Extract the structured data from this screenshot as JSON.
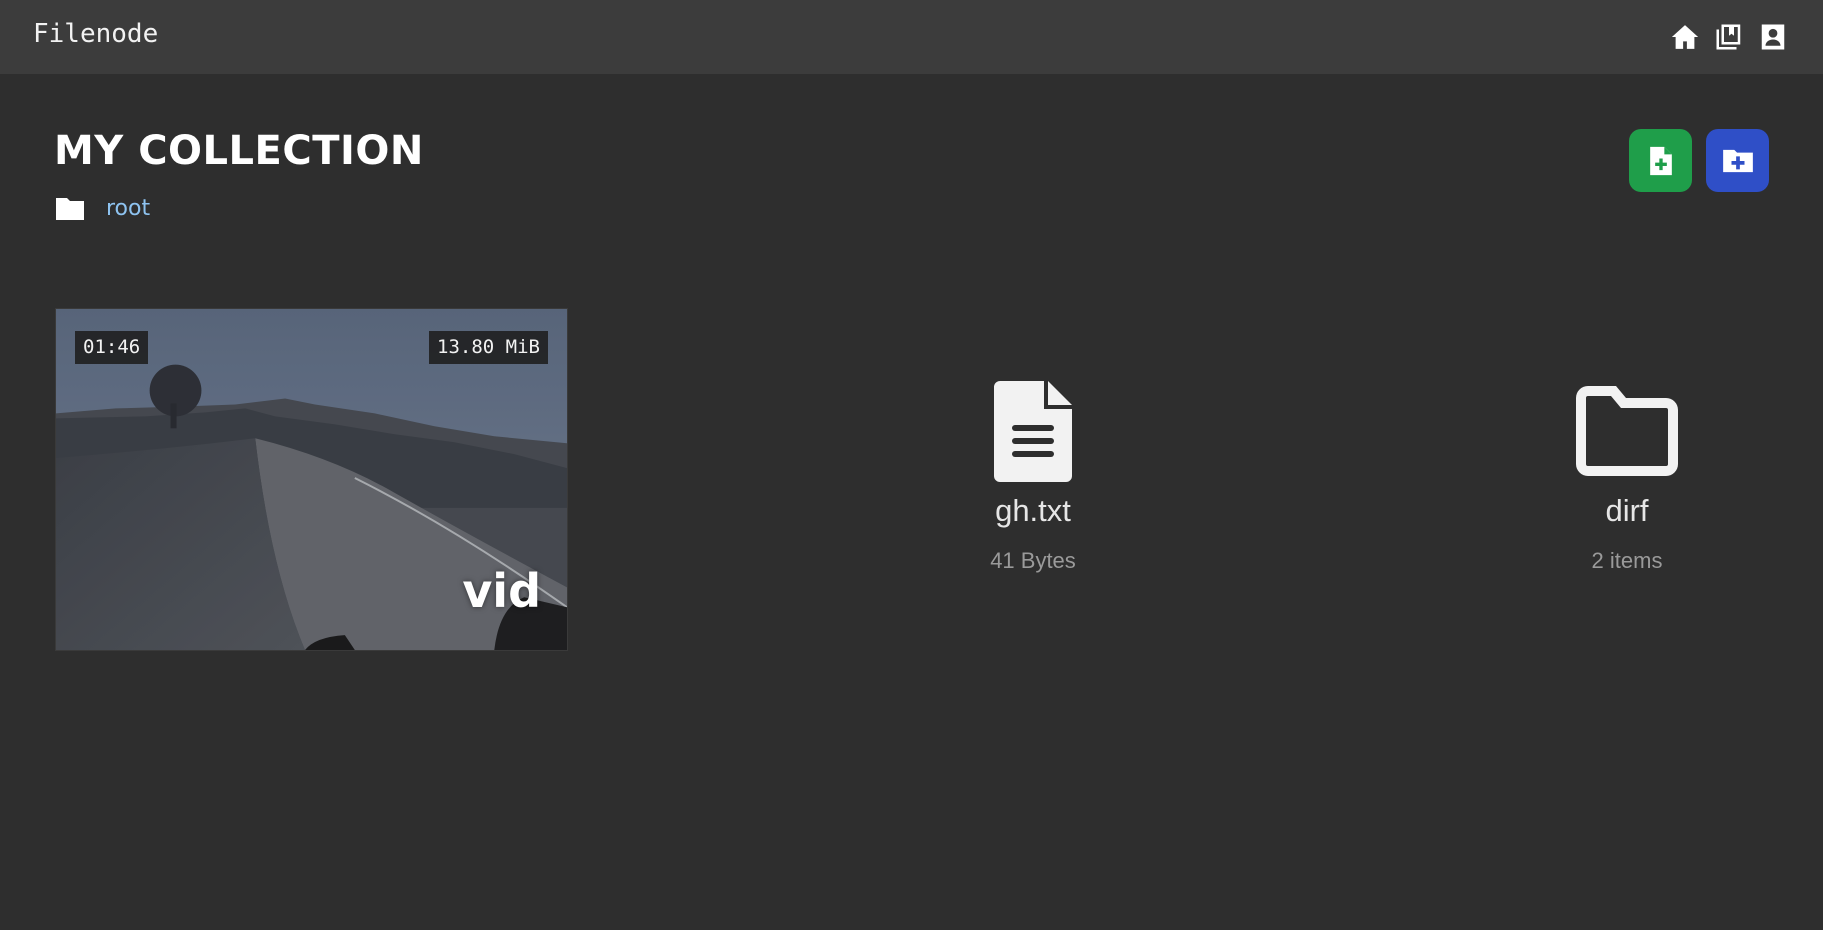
{
  "app": {
    "brand": "Filenode"
  },
  "navbar": {
    "icons": [
      {
        "name": "home-icon"
      },
      {
        "name": "bookmarks-icon"
      },
      {
        "name": "account-icon"
      }
    ]
  },
  "header": {
    "title": "MY COLLECTION",
    "breadcrumb": [
      {
        "label": "root",
        "icon": "folder-icon"
      }
    ]
  },
  "actions": {
    "new_file": {
      "icon": "file-plus-icon",
      "color": "#1f9e4a"
    },
    "new_folder": {
      "icon": "folder-plus-icon",
      "color": "#2f4fc7"
    }
  },
  "items": {
    "video": {
      "name": "vid",
      "duration": "01:46",
      "size": "13.80 MiB"
    },
    "file": {
      "name": "gh.txt",
      "meta": "41 Bytes",
      "icon": "text-file-icon"
    },
    "folder": {
      "name": "dirf",
      "meta": "2 items",
      "icon": "folder-icon"
    }
  },
  "colors": {
    "background": "#2e2e2e",
    "navbar": "#3c3c3c",
    "link": "#8ec3f0"
  }
}
